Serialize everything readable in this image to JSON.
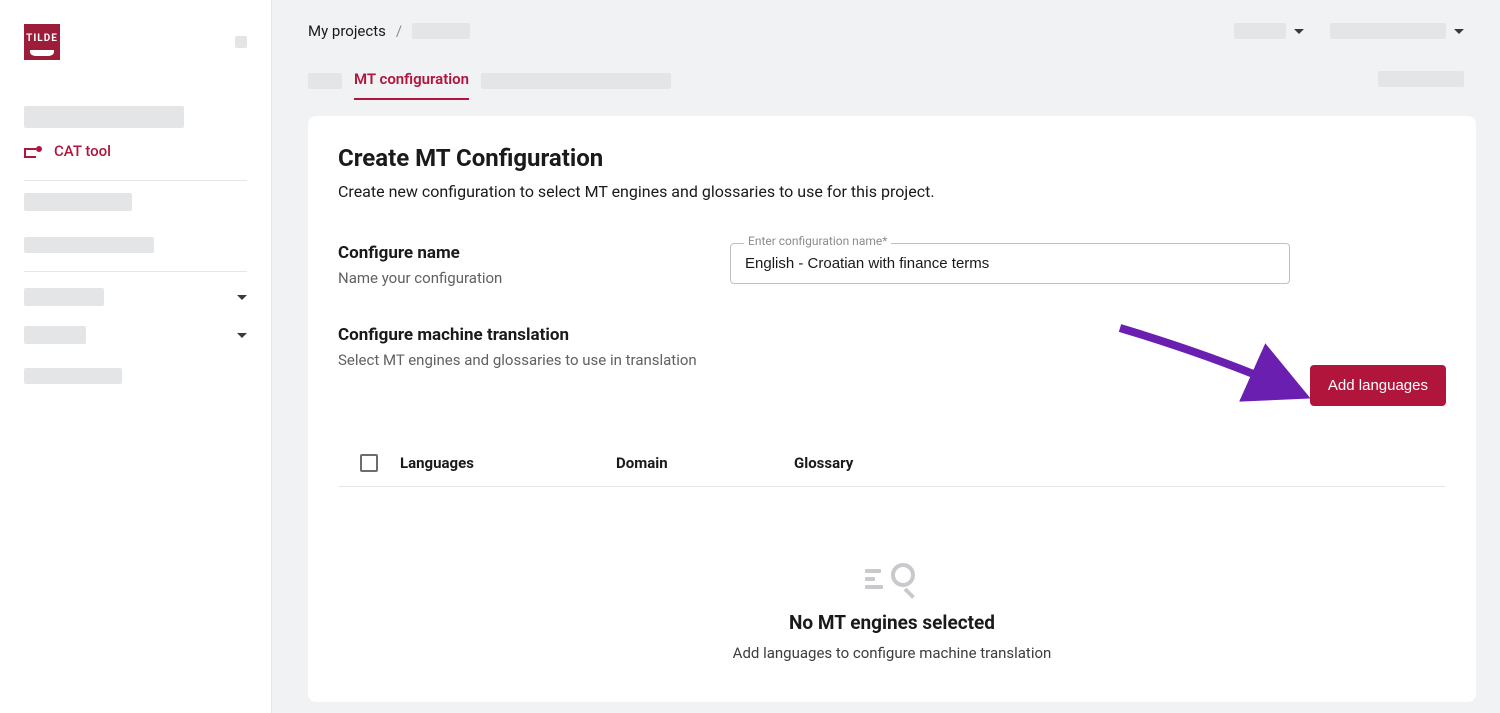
{
  "logo_text": "TILDE",
  "sidebar": {
    "cat_tool_label": "CAT tool"
  },
  "breadcrumb": {
    "root": "My projects",
    "sep": "/"
  },
  "tabs": {
    "mt_config": "MT configuration"
  },
  "card": {
    "title": "Create MT Configuration",
    "subtitle": "Create new configuration to select MT engines and glossaries to use for this project.",
    "configure_name_heading": "Configure name",
    "configure_name_help": "Name your configuration",
    "input_label": "Enter configuration name*",
    "input_value": "English - Croatian with finance terms",
    "configure_mt_heading": "Configure machine translation",
    "configure_mt_help": "Select MT engines and glossaries to use in translation",
    "add_languages_button": "Add languages",
    "table": {
      "col_languages": "Languages",
      "col_domain": "Domain",
      "col_glossary": "Glossary"
    },
    "empty_title": "No MT engines selected",
    "empty_sub": "Add languages to configure machine translation"
  }
}
